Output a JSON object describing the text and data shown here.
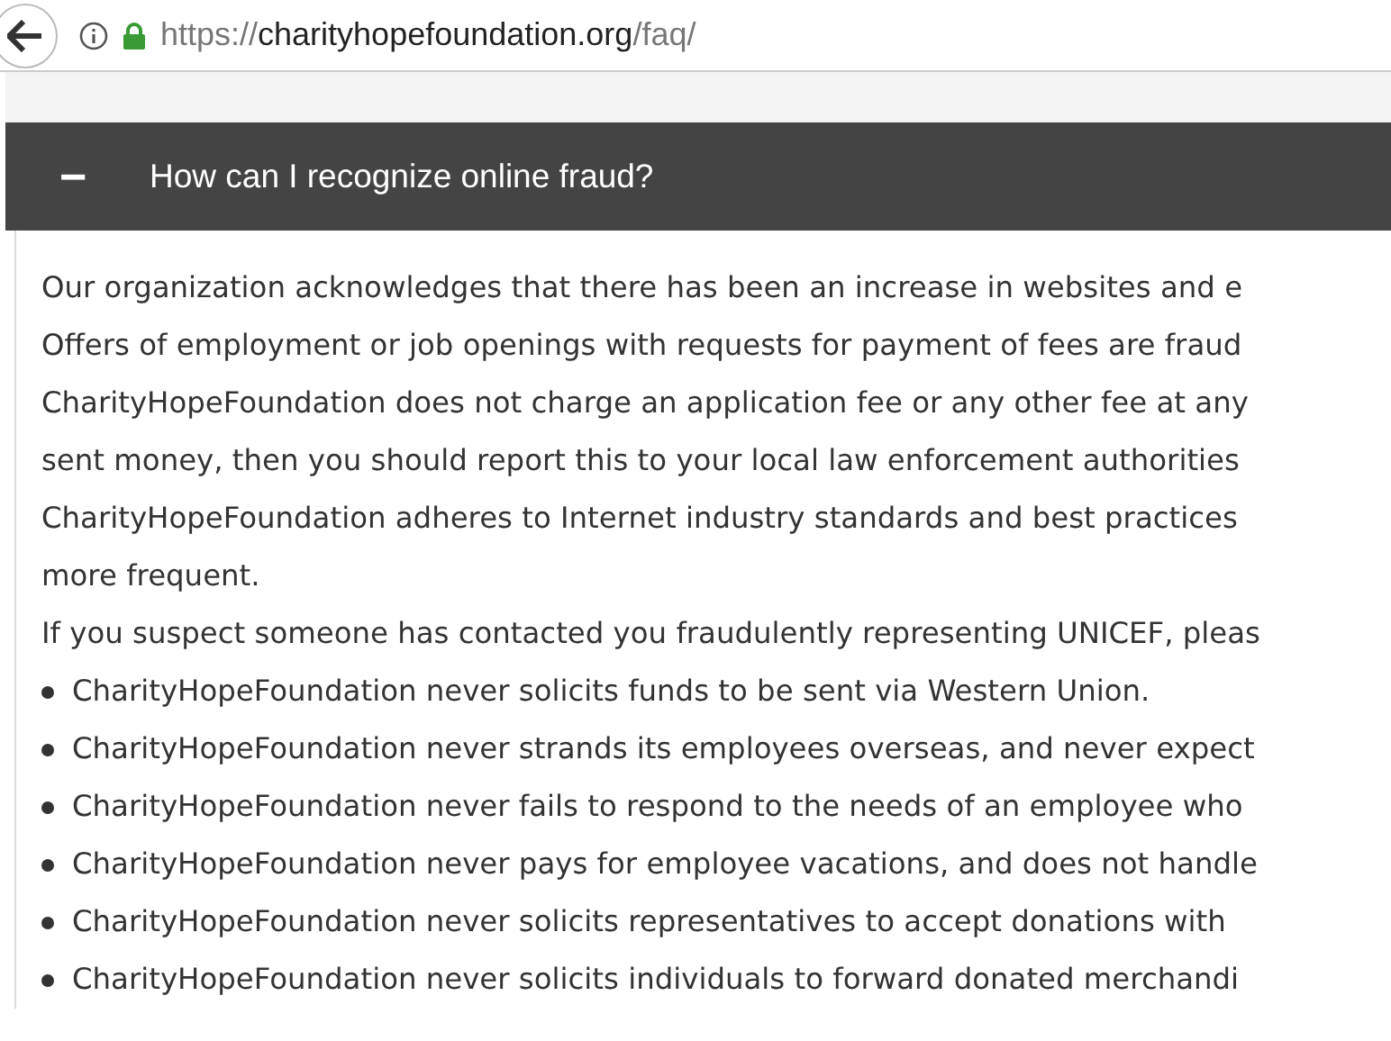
{
  "address_bar": {
    "scheme": "https://",
    "host": "charityhopefoundation.org",
    "path": "/faq/"
  },
  "accordion": {
    "expanded": true,
    "toggle": "−",
    "question": "How can I recognize online fraud?"
  },
  "answer_lines": [
    "Our organization acknowledges that there has been an increase in websites and e",
    "Offers of employment or job openings with requests for payment of fees are fraud",
    "CharityHopeFoundation does not charge an application fee or any other fee at any",
    "sent money, then you should report this to your local law enforcement authorities",
    "CharityHopeFoundation adheres to Internet industry standards and best practices",
    "more frequent.",
    "If you suspect someone has contacted you fraudulently representing UNICEF, pleas"
  ],
  "bullets": [
    "CharityHopeFoundation never solicits funds to be sent via Western Union.",
    "CharityHopeFoundation never strands its employees overseas, and never expect",
    "CharityHopeFoundation never fails to respond to the needs of an employee who",
    "CharityHopeFoundation never pays for employee vacations, and does not handle",
    "CharityHopeFoundation never solicits representatives to accept donations with",
    "CharityHopeFoundation never solicits individuals to forward donated merchandi"
  ]
}
